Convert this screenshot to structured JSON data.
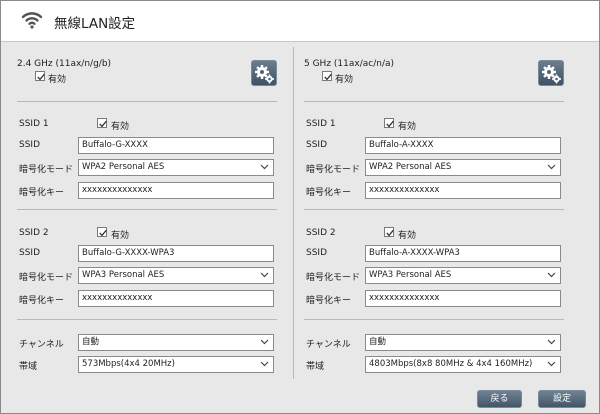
{
  "header": {
    "title": "無線LAN設定",
    "icon": "wifi-icon"
  },
  "left": {
    "band": "2.4 GHz (11ax/n/g/b)",
    "enabled_label": "有効",
    "ssid1": {
      "heading": "SSID 1",
      "enable_label": "有効",
      "ssid_label": "SSID",
      "ssid_value": "Buffalo-G-XXXX",
      "mode_label": "暗号化モード",
      "mode_value": "WPA2 Personal AES",
      "key_label": "暗号化キー",
      "key_value": "xxxxxxxxxxxxxx"
    },
    "ssid2": {
      "heading": "SSID 2",
      "enable_label": "有効",
      "ssid_label": "SSID",
      "ssid_value": "Buffalo-G-XXXX-WPA3",
      "mode_label": "暗号化モード",
      "mode_value": "WPA3 Personal AES",
      "key_label": "暗号化キー",
      "key_value": "xxxxxxxxxxxxxx"
    },
    "channel_label": "チャンネル",
    "channel_value": "自動",
    "bandwidth_label": "帯域",
    "bandwidth_value": "573Mbps(4x4 20MHz)"
  },
  "right": {
    "band": "5 GHz (11ax/ac/n/a)",
    "enabled_label": "有効",
    "ssid1": {
      "heading": "SSID 1",
      "enable_label": "有効",
      "ssid_label": "SSID",
      "ssid_value": "Buffalo-A-XXXX",
      "mode_label": "暗号化モード",
      "mode_value": "WPA2 Personal AES",
      "key_label": "暗号化キー",
      "key_value": "xxxxxxxxxxxxxx"
    },
    "ssid2": {
      "heading": "SSID 2",
      "enable_label": "有効",
      "ssid_label": "SSID",
      "ssid_value": "Buffalo-A-XXXX-WPA3",
      "mode_label": "暗号化モード",
      "mode_value": "WPA3 Personal AES",
      "key_label": "暗号化キー",
      "key_value": "xxxxxxxxxxxxxx"
    },
    "channel_label": "チャンネル",
    "channel_value": "自動",
    "bandwidth_label": "帯域",
    "bandwidth_value": "4803Mbps(8x8 80MHz & 4x4 160MHz)"
  },
  "footer": {
    "back_label": "戻る",
    "apply_label": "設定"
  },
  "colors": {
    "button_top": "#6f8295",
    "button_bottom": "#435667",
    "panel_bg": "#e8e8e8",
    "wifi_icon": "#555555"
  }
}
